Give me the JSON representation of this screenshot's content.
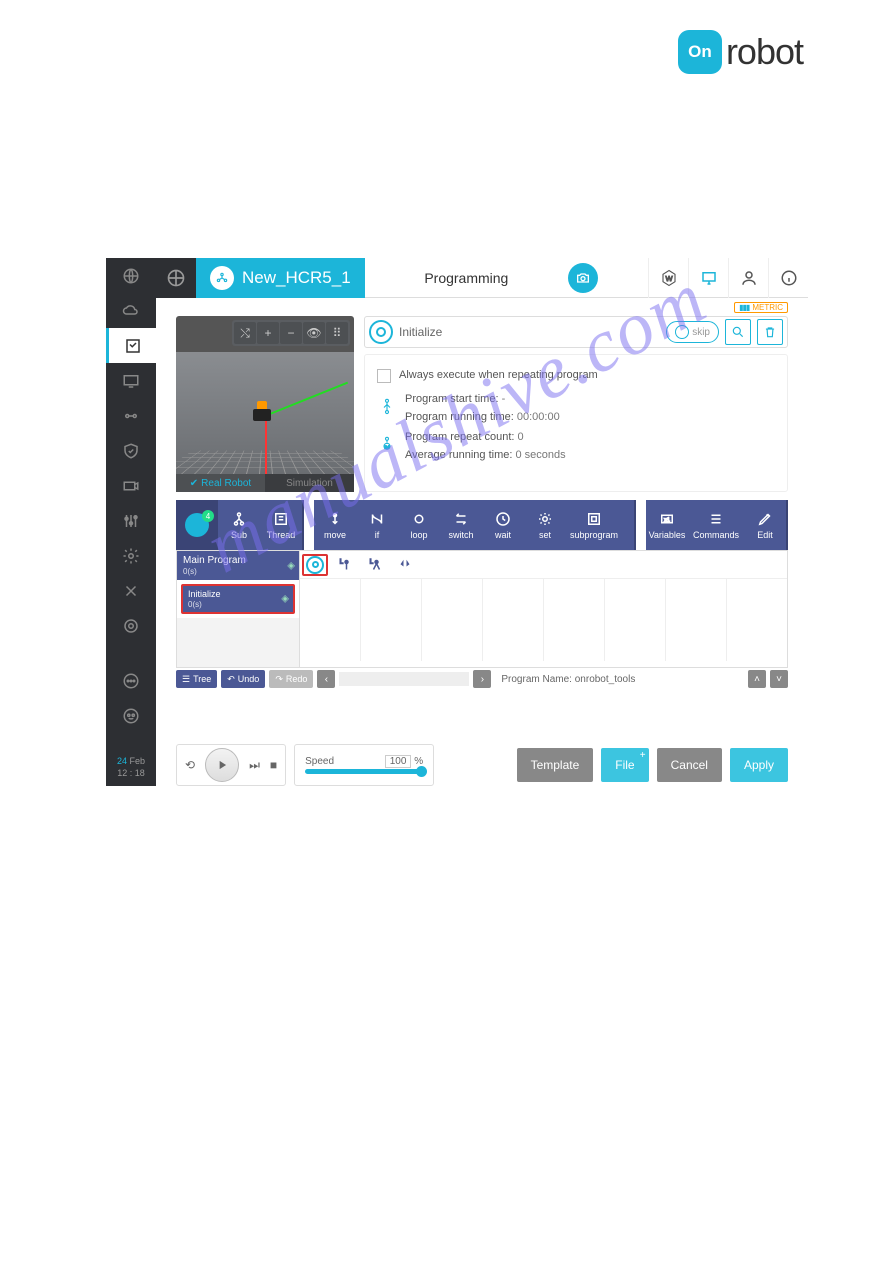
{
  "brand": {
    "badge": "On",
    "name": "robot"
  },
  "watermark": "manualshive.com",
  "topbar": {
    "program_name": "New_HCR5_1",
    "center_title": "Programming",
    "icons": [
      "hexagon-w-icon",
      "monitor-icon",
      "user-icon",
      "info-icon"
    ]
  },
  "metric_badge": "METRIC",
  "sidebar_date": {
    "day": "24",
    "month": "Feb",
    "time": "12 : 18"
  },
  "viewport": {
    "tabs": {
      "real": "Real Robot",
      "sim": "Simulation"
    }
  },
  "init": {
    "title": "Initialize",
    "skip_label": "skip",
    "checkbox_label": "Always execute when repeating program",
    "start_time_label": "Program start time:",
    "start_time_value": "-",
    "run_time_label": "Program running time:",
    "run_time_value": "00:00:00",
    "repeat_label": "Program repeat count:",
    "repeat_value": "0",
    "avg_label": "Average running time:",
    "avg_value": "0 seconds"
  },
  "ribbon": {
    "node_badge": "4",
    "sub": "Sub",
    "thread": "Thread",
    "move": "move",
    "if": "if",
    "loop": "loop",
    "switch": "switch",
    "wait": "wait",
    "set": "set",
    "subprogram": "subprogram",
    "variables": "Variables",
    "commands": "Commands",
    "edit": "Edit"
  },
  "timeline": {
    "main_label": "Main Program",
    "main_sub": "0(s)",
    "init_label": "Initialize",
    "init_sub": "0(s)"
  },
  "tlfooter": {
    "tree": "Tree",
    "undo": "Undo",
    "redo": "Redo",
    "prog_label": "Program Name:",
    "prog_value": "onrobot_tools"
  },
  "footer": {
    "speed_label": "Speed",
    "speed_value": "100",
    "speed_unit": "%",
    "template": "Template",
    "file": "File",
    "cancel": "Cancel",
    "apply": "Apply"
  }
}
